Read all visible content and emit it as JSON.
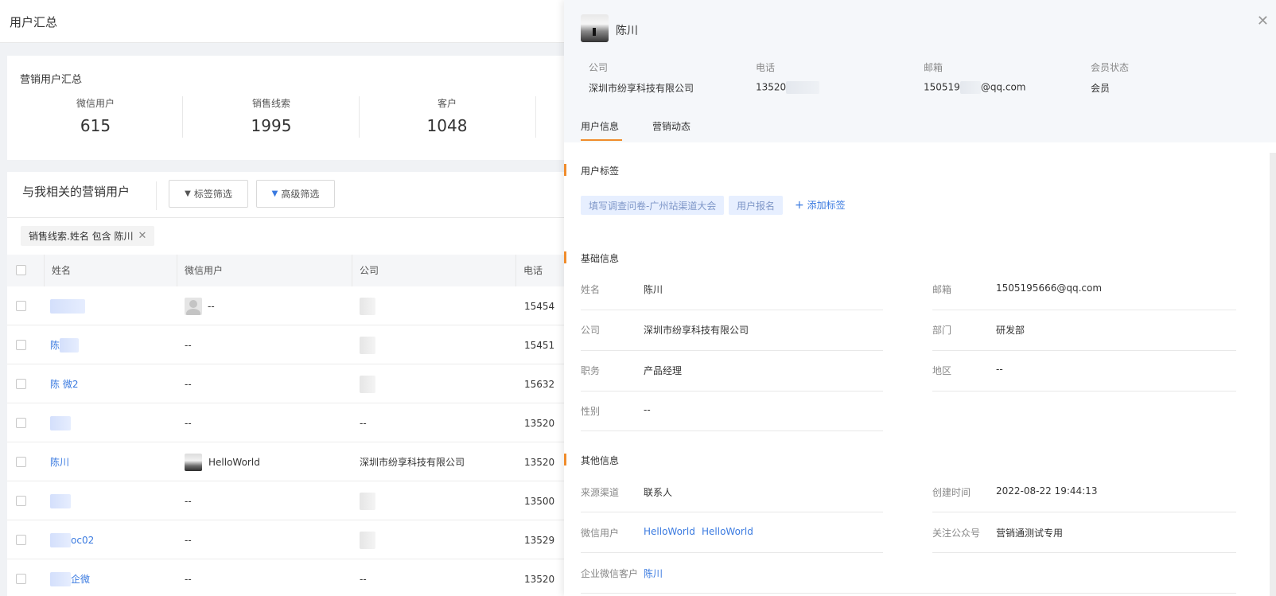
{
  "page": {
    "title": "用户汇总"
  },
  "summary": {
    "title": "营销用户汇总",
    "stats": [
      {
        "label": "微信用户",
        "value": "615"
      },
      {
        "label": "销售线索",
        "value": "1995"
      },
      {
        "label": "客户",
        "value": "1048"
      }
    ]
  },
  "list": {
    "title": "与我相关的营销用户",
    "tag_filter_label": "标签筛选",
    "advanced_filter_label": "高级筛选",
    "chip_label": "销售线索.姓名 包含 陈川",
    "columns": [
      "姓名",
      "微信用户",
      "公司",
      "电话"
    ],
    "rows": [
      {
        "name": "",
        "wechat": "--",
        "company": "",
        "phone": "15454"
      },
      {
        "name": "陈",
        "wechat": "--",
        "company": "",
        "phone": "15451"
      },
      {
        "name": "陈 微2",
        "wechat": "--",
        "company": "",
        "phone": "15632"
      },
      {
        "name": "",
        "wechat": "--",
        "company": "--",
        "phone": "13520"
      },
      {
        "name": "陈川",
        "wechat": "HelloWorld",
        "company": "深圳市纷享科技有限公司",
        "phone": "13520"
      },
      {
        "name": "",
        "wechat": "--",
        "company": "",
        "phone": "13500"
      },
      {
        "name": "oc02",
        "wechat": "--",
        "company": "",
        "phone": "13529"
      },
      {
        "name": "企微",
        "wechat": "--",
        "company": "--",
        "phone": "13520"
      }
    ]
  },
  "drawer": {
    "name": "陈川",
    "meta": [
      {
        "label": "公司",
        "value": "深圳市纷享科技有限公司"
      },
      {
        "label": "电话",
        "value": "13520"
      },
      {
        "label": "邮箱",
        "prefix": "150519",
        "suffix": "@qq.com"
      },
      {
        "label": "会员状态",
        "value": "会员"
      }
    ],
    "tabs": [
      "用户信息",
      "营销动态"
    ],
    "tags_section": "用户标签",
    "tags": [
      "填写调查问卷-广州站渠道大会",
      "用户报名"
    ],
    "add_tag": "添加标签",
    "basic_section": "基础信息",
    "basic_fields": [
      {
        "label": "姓名",
        "value": "陈川"
      },
      {
        "label": "邮箱",
        "value": "1505195666@qq.com"
      },
      {
        "label": "公司",
        "value": "深圳市纷享科技有限公司"
      },
      {
        "label": "部门",
        "value": "研发部"
      },
      {
        "label": "职务",
        "value": "产品经理"
      },
      {
        "label": "地区",
        "value": "--"
      },
      {
        "label": "性别",
        "value": "--"
      }
    ],
    "other_section": "其他信息",
    "other_fields": [
      {
        "label": "来源渠道",
        "value": "联系人"
      },
      {
        "label": "创建时间",
        "value": "2022-08-22 19:44:13"
      },
      {
        "label": "微信用户",
        "links": [
          "HelloWorld",
          "HelloWorld"
        ]
      },
      {
        "label": "关注公众号",
        "value": "营销通测试专用"
      },
      {
        "label": "企业微信客户",
        "link": "陈川"
      }
    ]
  }
}
